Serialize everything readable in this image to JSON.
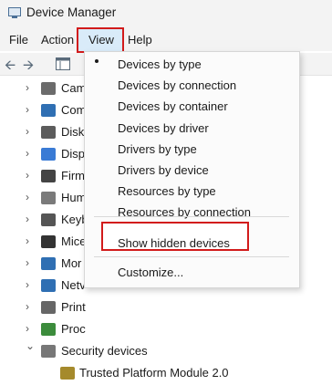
{
  "window": {
    "title": "Device Manager"
  },
  "menubar": {
    "file": "File",
    "action": "Action",
    "view": "View",
    "help": "Help"
  },
  "view_menu": {
    "items": [
      "Devices by type",
      "Devices by connection",
      "Devices by container",
      "Devices by driver",
      "Drivers by type",
      "Drivers by device",
      "Resources by type",
      "Resources by connection"
    ],
    "show_hidden": "Show hidden devices",
    "customize": "Customize..."
  },
  "tree": {
    "items": [
      "Cam",
      "Com",
      "Disk",
      "Disp",
      "Firm",
      "Hum",
      "Keyb",
      "Mice",
      "Mor",
      "Netv",
      "Print",
      "Proc",
      "Security devices"
    ],
    "child": "Trusted Platform Module 2.0"
  },
  "colors": {
    "highlight_border": "#d21b1b",
    "active_menu_bg": "#d9ebf9"
  }
}
